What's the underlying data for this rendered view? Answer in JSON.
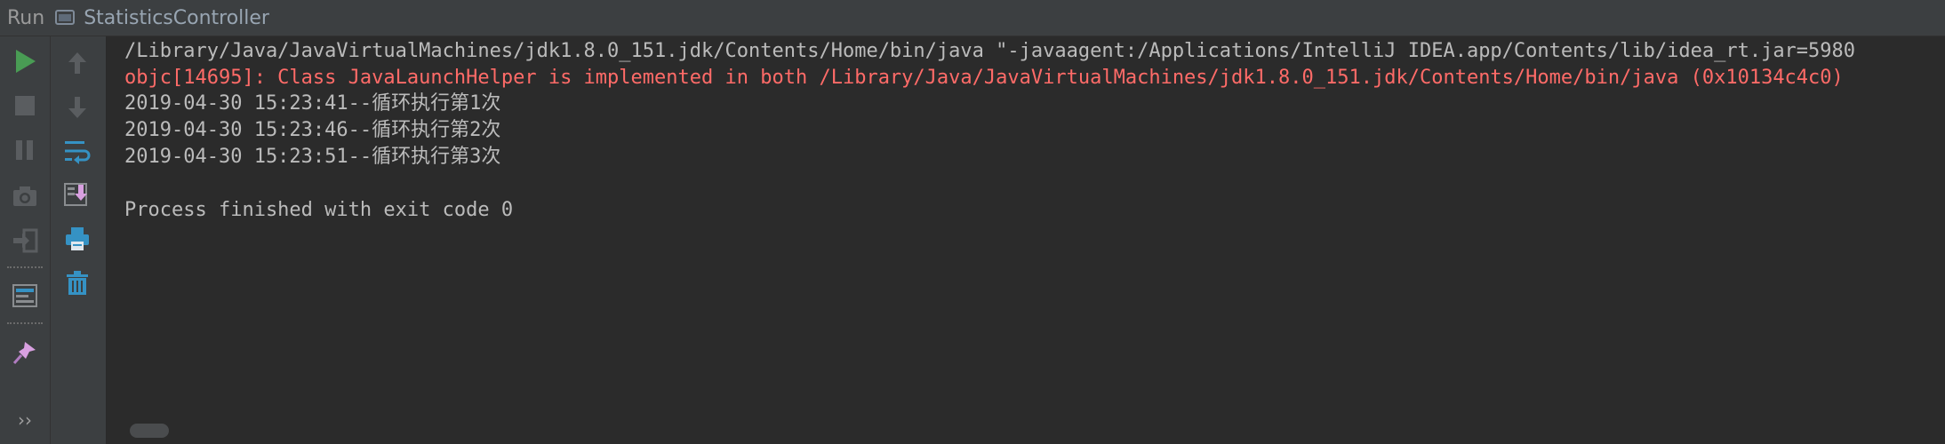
{
  "title_bar": {
    "run_label": "Run",
    "tab_name": "StatisticsController"
  },
  "left_toolbar": {
    "tools": [
      "run-icon",
      "stop-icon",
      "pause-icon",
      "camera-icon",
      "exit-icon",
      "layout-icon",
      "pin-icon",
      "more-icon"
    ],
    "more_label": "››"
  },
  "mid_toolbar": {
    "tools": [
      "up-arrow-icon",
      "down-arrow-icon",
      "soft-wrap-icon",
      "scroll-to-end-icon",
      "print-icon",
      "trash-icon"
    ]
  },
  "console": {
    "lines": [
      "/Library/Java/JavaVirtualMachines/jdk1.8.0_151.jdk/Contents/Home/bin/java \"-javaagent:/Applications/IntelliJ IDEA.app/Contents/lib/idea_rt.jar=5980",
      "objc[14695]: Class JavaLaunchHelper is implemented in both /Library/Java/JavaVirtualMachines/jdk1.8.0_151.jdk/Contents/Home/bin/java (0x10134c4c0)",
      "2019-04-30 15:23:41--循环执行第1次",
      "2019-04-30 15:23:46--循环执行第2次",
      "2019-04-30 15:23:51--循环执行第3次",
      "",
      "Process finished with exit code 0"
    ]
  },
  "colors": {
    "run_green": "#499c54",
    "error_red": "#ff6b68",
    "text": "#bbbbbb",
    "icon_blue": "#3592c4",
    "icon_pink": "#d8a0e0"
  }
}
